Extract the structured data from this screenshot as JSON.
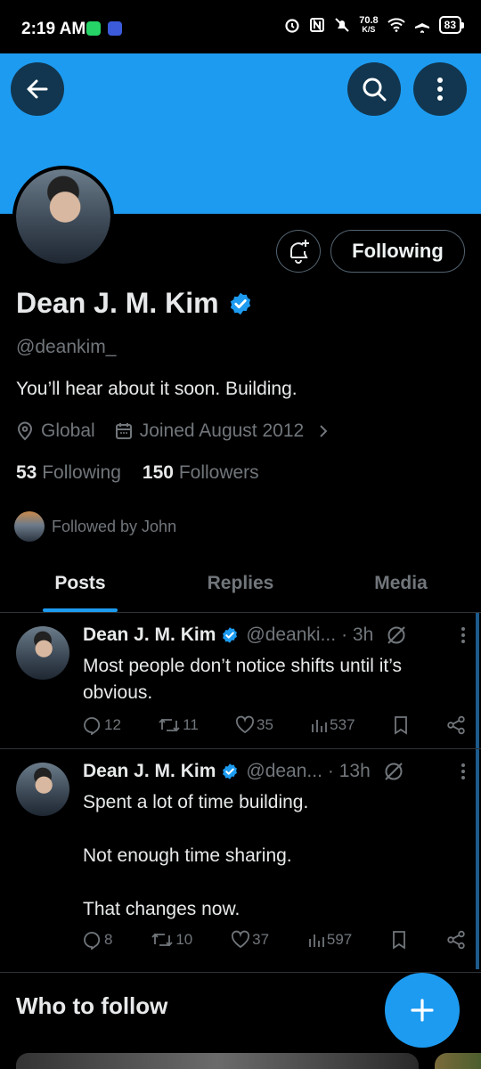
{
  "status_bar": {
    "time": "2:19 AM",
    "speed_value": "70.8",
    "speed_unit": "K/S",
    "battery": "83"
  },
  "profile": {
    "display_name": "Dean J. M. Kim",
    "handle": "@deankim_",
    "bio": "You’ll hear about it soon.  Building.",
    "location": "Global",
    "joined": "Joined August 2012",
    "following_count": "53",
    "following_label": "Following",
    "followers_count": "150",
    "followers_label": "Followers",
    "followed_by": "Followed by John",
    "follow_button_label": "Following"
  },
  "tabs": [
    {
      "label": "Posts",
      "active": true
    },
    {
      "label": "Replies",
      "active": false
    },
    {
      "label": "Media",
      "active": false
    }
  ],
  "posts": [
    {
      "name": "Dean J. M. Kim",
      "handle": "@deanki...",
      "time": "· 3h",
      "text": "Most people don’t notice shifts until it’s obvious.",
      "replies": "12",
      "reposts": "11",
      "likes": "35",
      "views": "537"
    },
    {
      "name": "Dean J. M. Kim",
      "handle": "@dean...",
      "time": "· 13h",
      "text": "Spent a lot of time building.\n\nNot enough time sharing.\n\nThat changes now.",
      "replies": "8",
      "reposts": "10",
      "likes": "37",
      "views": "597"
    }
  ],
  "who_to_follow": {
    "title": "Who to follow"
  },
  "colors": {
    "accent": "#1d9bf0",
    "background": "#000000",
    "muted": "#71767b",
    "text": "#e7e9ea"
  },
  "icons": [
    "back-arrow-icon",
    "search-icon",
    "more-vertical-icon",
    "bell-plus-icon",
    "verified-badge-icon",
    "location-icon",
    "calendar-icon",
    "chevron-right-icon",
    "reply-icon",
    "repost-icon",
    "like-icon",
    "views-icon",
    "bookmark-icon",
    "share-icon",
    "grok-icon",
    "plus-icon"
  ]
}
